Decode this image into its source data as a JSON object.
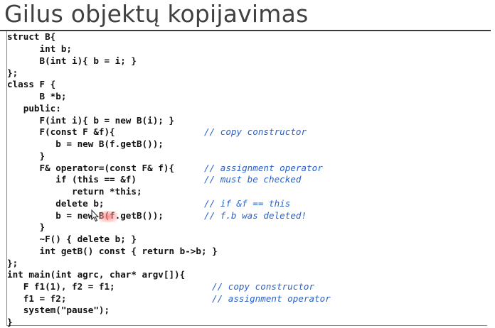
{
  "slide": {
    "title": "Gilus objektų kopijavimas"
  },
  "code": {
    "comment_color": "#2b62c9",
    "lines": [
      {
        "text": "struct B{",
        "comment": ""
      },
      {
        "text": "      int b;",
        "comment": ""
      },
      {
        "text": "      B(int i){ b = i; }",
        "comment": ""
      },
      {
        "text": "};",
        "comment": ""
      },
      {
        "text": "class F {",
        "comment": ""
      },
      {
        "text": "      B *b;",
        "comment": ""
      },
      {
        "text": "   public:",
        "comment": ""
      },
      {
        "text": "      F(int i){ b = new B(i); }",
        "comment": ""
      },
      {
        "text": "      F(const F &f){",
        "comment": "// copy constructor"
      },
      {
        "text": "         b = new B(f.getB());",
        "comment": ""
      },
      {
        "text": "      }",
        "comment": ""
      },
      {
        "text": "      F& operator=(const F& f){",
        "comment": "// assignment operator"
      },
      {
        "text": "         if (this == &f)",
        "comment": "// must be checked"
      },
      {
        "text": "            return *this;",
        "comment": ""
      },
      {
        "text": "         delete b;",
        "comment": "// if &f == this"
      },
      {
        "text": "         b = new B(f.getB());",
        "comment": "// f.b was deleted!"
      },
      {
        "text": "      }",
        "comment": ""
      },
      {
        "text": "      ~F() { delete b; }",
        "comment": ""
      },
      {
        "text": "      int getB() const { return b->b; }",
        "comment": ""
      },
      {
        "text": "};",
        "comment": ""
      },
      {
        "text": "int main(int agrc, char* argv[]){",
        "comment": ""
      },
      {
        "text": "   F f1(1), f2 = f1;",
        "comment": "// copy constructor"
      },
      {
        "text": "   f1 = f2;",
        "comment": "// assignment operator"
      },
      {
        "text": "   system(\"pause\");",
        "comment": ""
      },
      {
        "text": "}",
        "comment": ""
      }
    ]
  },
  "cursor": {
    "icon": "arrow-pointer-icon",
    "highlight_color": "#ff7a7a"
  }
}
